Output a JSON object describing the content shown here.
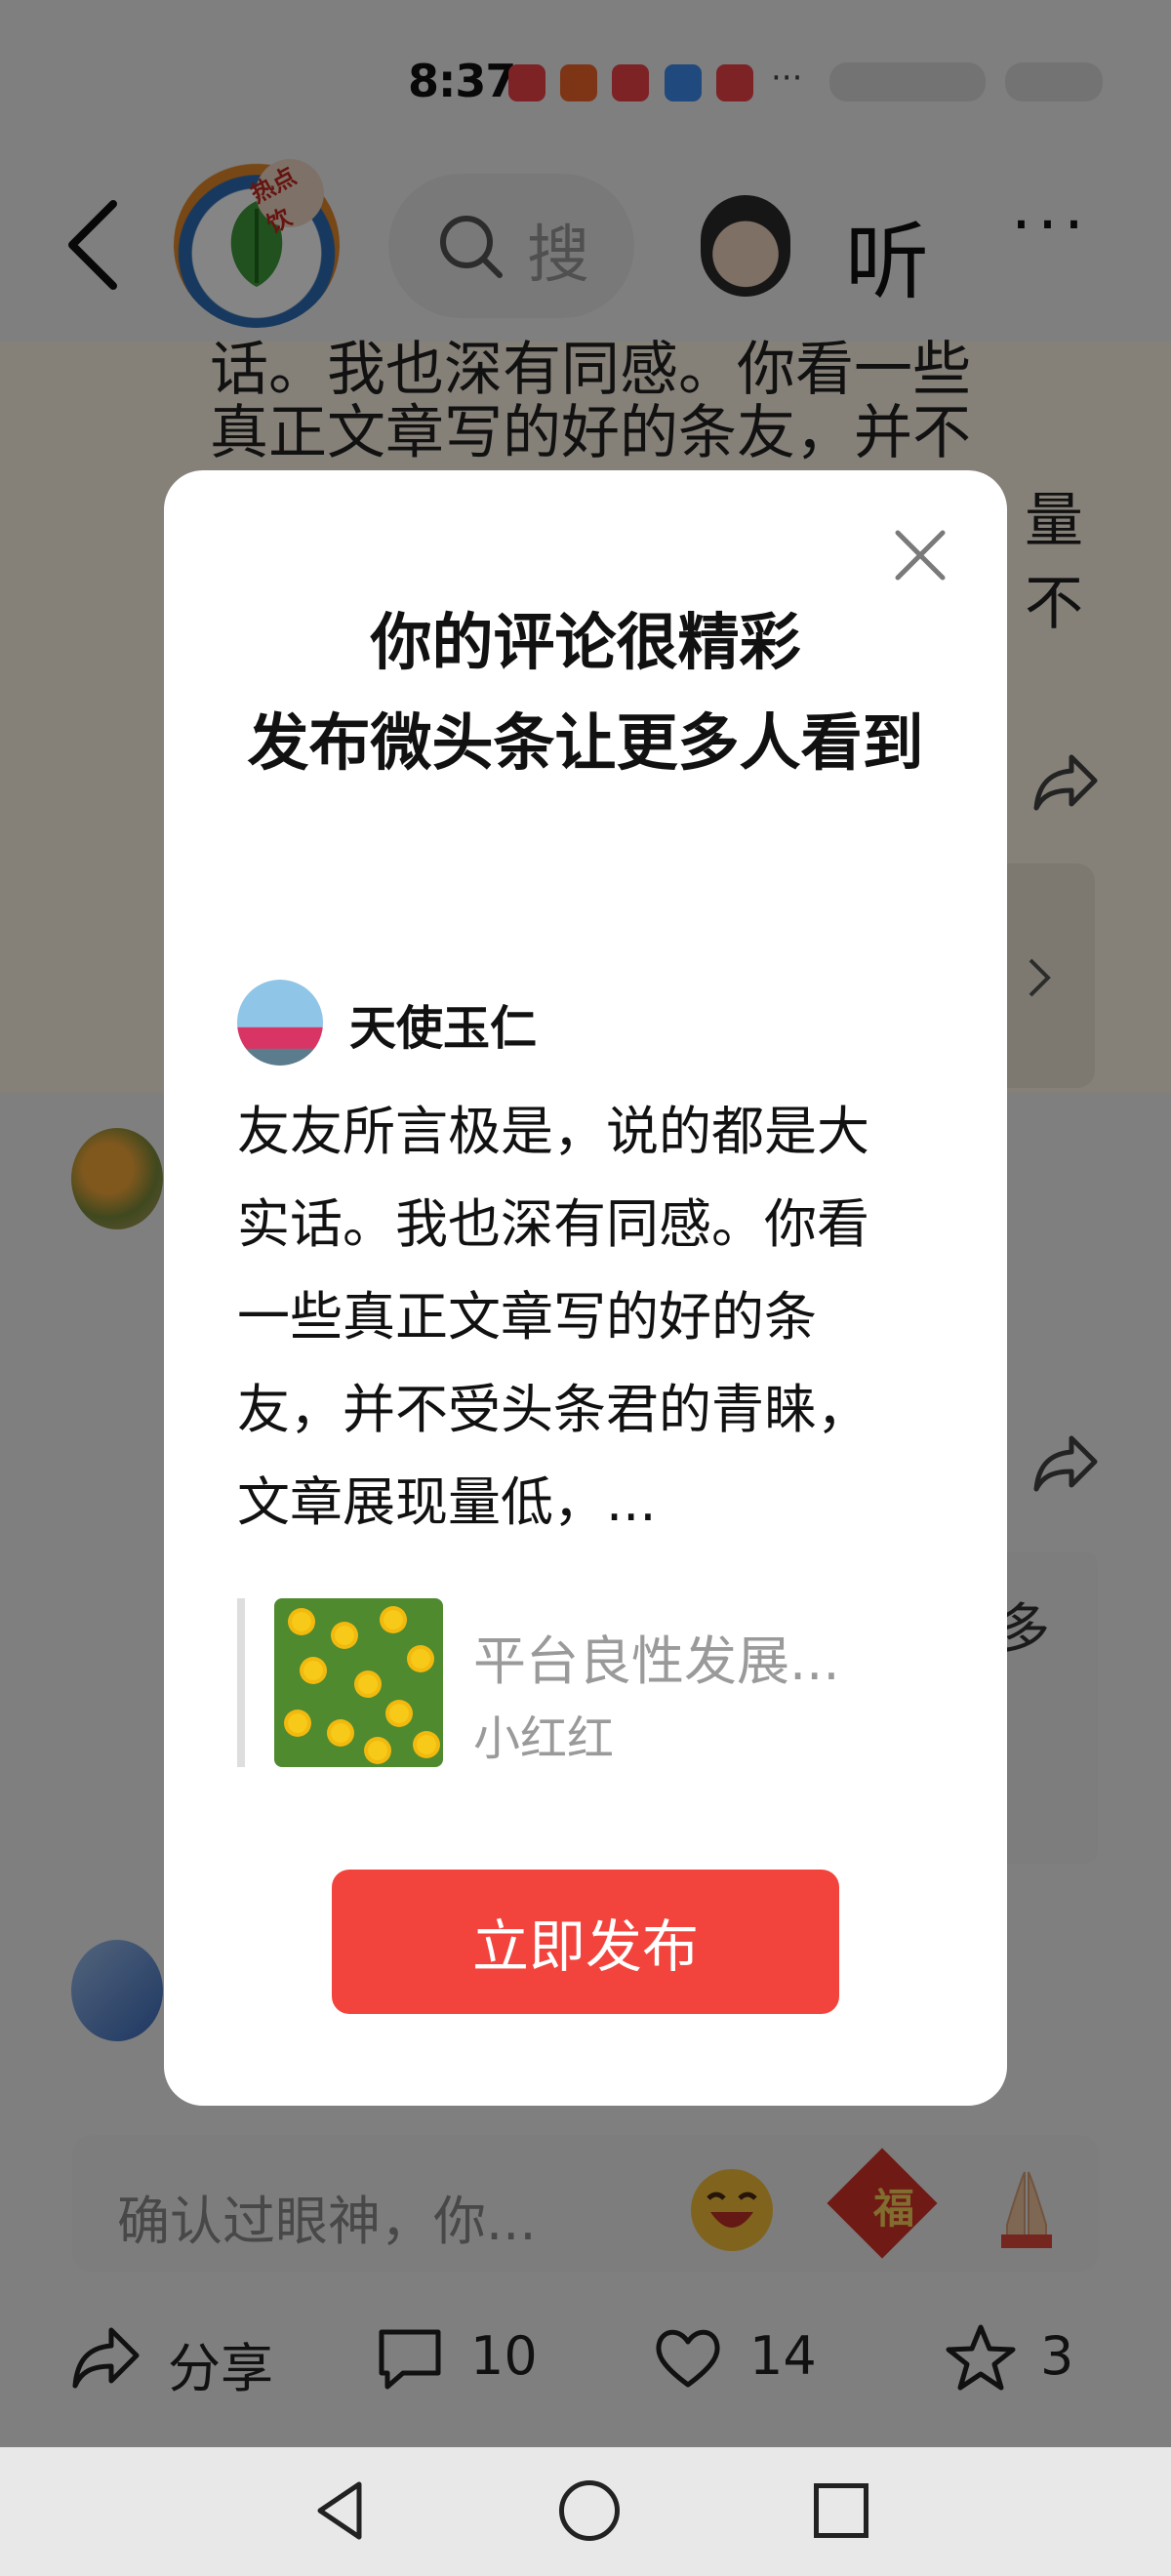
{
  "status_bar": {
    "time": "8:37",
    "more": "···"
  },
  "header": {
    "back_icon": "chevron-left-icon",
    "channel_logo_badge": "热点饮",
    "search_icon": "search-icon",
    "search_text": "搜",
    "listen_label": "听",
    "more_label": "···"
  },
  "background": {
    "article_line1": "话。我也深有同感。你看一些",
    "article_line2": "真正文章写的好的条友，并不",
    "article_fragment_a": "量",
    "article_fragment_b": "不",
    "card_fragment": "多"
  },
  "comment_bar": {
    "placeholder": "确认过眼神，你...",
    "emojis": [
      "laughing-emoji",
      "fu-emoji",
      "praying-hands-emoji"
    ],
    "fu_char": "福"
  },
  "action_bar": {
    "share_label": "分享",
    "comment_count": "10",
    "like_count": "14",
    "favorite_count": "3"
  },
  "modal": {
    "title_line1": "你的评论很精彩",
    "title_line2": "发布微头条让更多人看到",
    "user_name": "天使玉仁",
    "comment_text": "友友所言极是，说的都是大实话。我也深有同感。你看一些真正文章写的好的条友，并不受头条君的青睐，文章展现量低，...",
    "quoted_article_title": "平台良性发展...",
    "quoted_article_author": "小红红",
    "publish_button": "立即发布"
  },
  "colors": {
    "accent_red": "#f3433d",
    "overlay": "rgba(0,0,0,0.48)",
    "muted_text": "#9a9a9a"
  }
}
